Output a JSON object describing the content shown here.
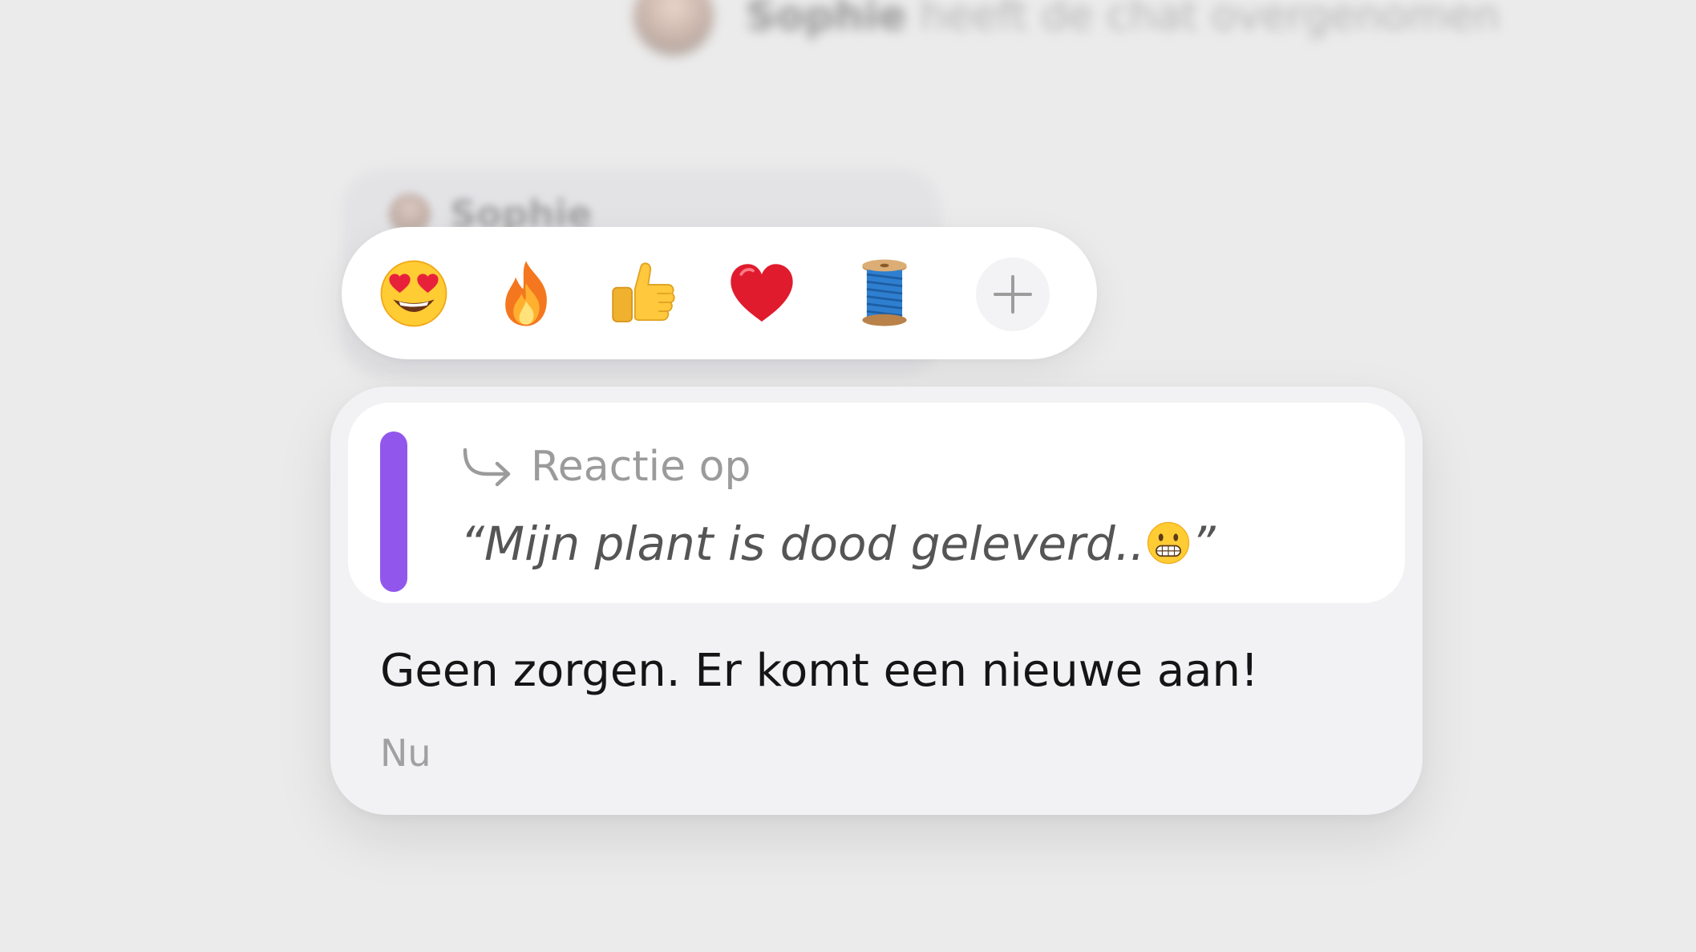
{
  "background": {
    "system_notice": {
      "name": "Sophie",
      "text": "heeft de chat overgenomen"
    },
    "sender_name": "Sophie"
  },
  "reaction_bar": {
    "emojis": [
      {
        "icon": "heart-eyes-emoji-icon",
        "char": "😍"
      },
      {
        "icon": "fire-emoji-icon",
        "char": "🔥"
      },
      {
        "icon": "thumbs-up-emoji-icon",
        "char": "👍"
      },
      {
        "icon": "red-heart-emoji-icon",
        "char": "❤️"
      },
      {
        "icon": "spool-of-thread-emoji-icon",
        "char": "🧵"
      }
    ],
    "add_icon": "plus-icon"
  },
  "message": {
    "reply": {
      "label": "Reactie op",
      "quote_text": "“Mijn plant is dood geleverd..",
      "quote_emoji": "😬",
      "quote_close": "”"
    },
    "body": "Geen zorgen. Er komt een nieuwe aan!",
    "time": "Nu"
  },
  "colors": {
    "accent": "#9157ed",
    "background": "#ebebeb",
    "card": "#f2f2f4"
  }
}
